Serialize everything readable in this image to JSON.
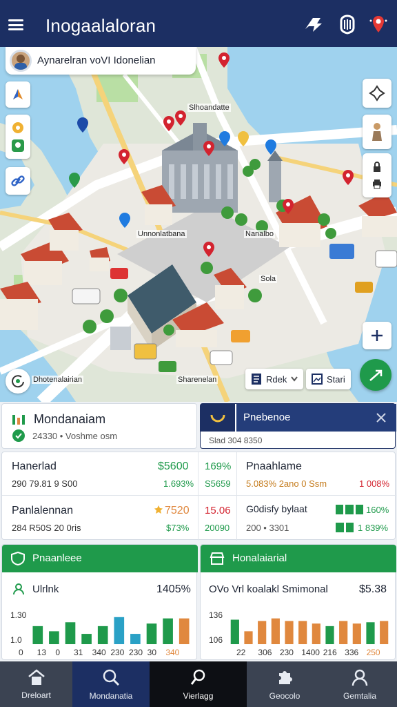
{
  "header": {
    "title": "Inogaalaloran"
  },
  "search": {
    "text": "Aynarelran voVI Idonelian"
  },
  "map": {
    "labels": [
      "Slhoandatte",
      "Unnonlatbana",
      "Nanalbo",
      "Sola",
      "Dhotenalairian",
      "Sharenelan"
    ],
    "chip_back": "Rdek",
    "chip_start": "Stari"
  },
  "panel_left": {
    "title": "Mondanaiam",
    "subtitle": "24330 • Voshme osm",
    "rows": [
      {
        "name": "Hanerlad",
        "value": "$5600",
        "sub": "290 79.81 9 S00",
        "pct": "1.693%"
      },
      {
        "name": "Panlalennan",
        "value": "7520",
        "sub": "284 R50S 20 0ris",
        "pct": "$73%"
      }
    ]
  },
  "panel_right": {
    "title": "Pnebenoe",
    "subtitle": "Slad 304 8350",
    "mid_col": [
      {
        "a": "169%",
        "b": "S5659"
      },
      {
        "a": "15.06",
        "b": "20090"
      }
    ],
    "rows": [
      {
        "name": "Pnaahlame",
        "sub": "5.083% 2ano 0 Ssm",
        "value": "1 008%"
      },
      {
        "name": "G0disfy bylaat",
        "sub": "200 • 3301",
        "value": "160%",
        "value2": "1 839%"
      }
    ]
  },
  "chart_left": {
    "header": "Pnaanleee",
    "series_label": "Ulrlnk",
    "total": "1405%",
    "y_ticks": [
      "1.30",
      "1.0"
    ],
    "x_ticks": [
      "0",
      "13",
      "0",
      "31",
      "340",
      "230",
      "230",
      "30",
      "340"
    ]
  },
  "chart_right": {
    "header": "Honalaiarial",
    "series_label": "OVo Vrl koalakl Smimonal",
    "total": "$5.38",
    "y_ticks": [
      "136",
      "106"
    ],
    "x_ticks": [
      "22",
      "306",
      "230",
      "1400",
      "216",
      "336",
      "250"
    ]
  },
  "chart_data": [
    {
      "type": "bar",
      "title": "Pnaanleee",
      "x": [
        "0",
        "13",
        "0",
        "31",
        "340",
        "230",
        "230",
        "30",
        "340"
      ],
      "series": [
        {
          "name": "Ulrlnk",
          "values": [
            1.14,
            1.1,
            1.17,
            1.08,
            1.14,
            1.21,
            1.08,
            1.16,
            1.2,
            1.2
          ]
        }
      ],
      "ylim": [
        1.0,
        1.3
      ],
      "colors": [
        "#1f9a4b",
        "#1f9a4b",
        "#1f9a4b",
        "#1f9a4b",
        "#1f9a4b",
        "#2aa1c6",
        "#2aa1c6",
        "#1f9a4b",
        "#1f9a4b",
        "#e0883e"
      ]
    },
    {
      "type": "bar",
      "title": "Honalaiarial",
      "x": [
        "22",
        "306",
        "230",
        "1400",
        "216",
        "336",
        "250"
      ],
      "series": [
        {
          "name": "OVo Vrl koalakl Smimonal",
          "values": [
            125,
            116,
            124,
            126,
            124,
            124,
            122,
            120,
            124,
            122,
            123,
            124
          ]
        }
      ],
      "ylim": [
        106,
        136
      ],
      "colors": [
        "#1f9a4b",
        "#e0883e",
        "#e0883e",
        "#e0883e",
        "#e0883e",
        "#e0883e",
        "#e0883e",
        "#1f9a4b",
        "#e0883e",
        "#e0883e",
        "#1f9a4b",
        "#e0883e"
      ]
    }
  ],
  "nav": {
    "items": [
      "Dreloart",
      "Mondanatia",
      "Vierlagg",
      "Geocolo",
      "Gemtalia"
    ]
  },
  "colors": {
    "header_bg": "#1c2f63",
    "green": "#1f9a4b",
    "nav_bg": "#3b4352"
  }
}
